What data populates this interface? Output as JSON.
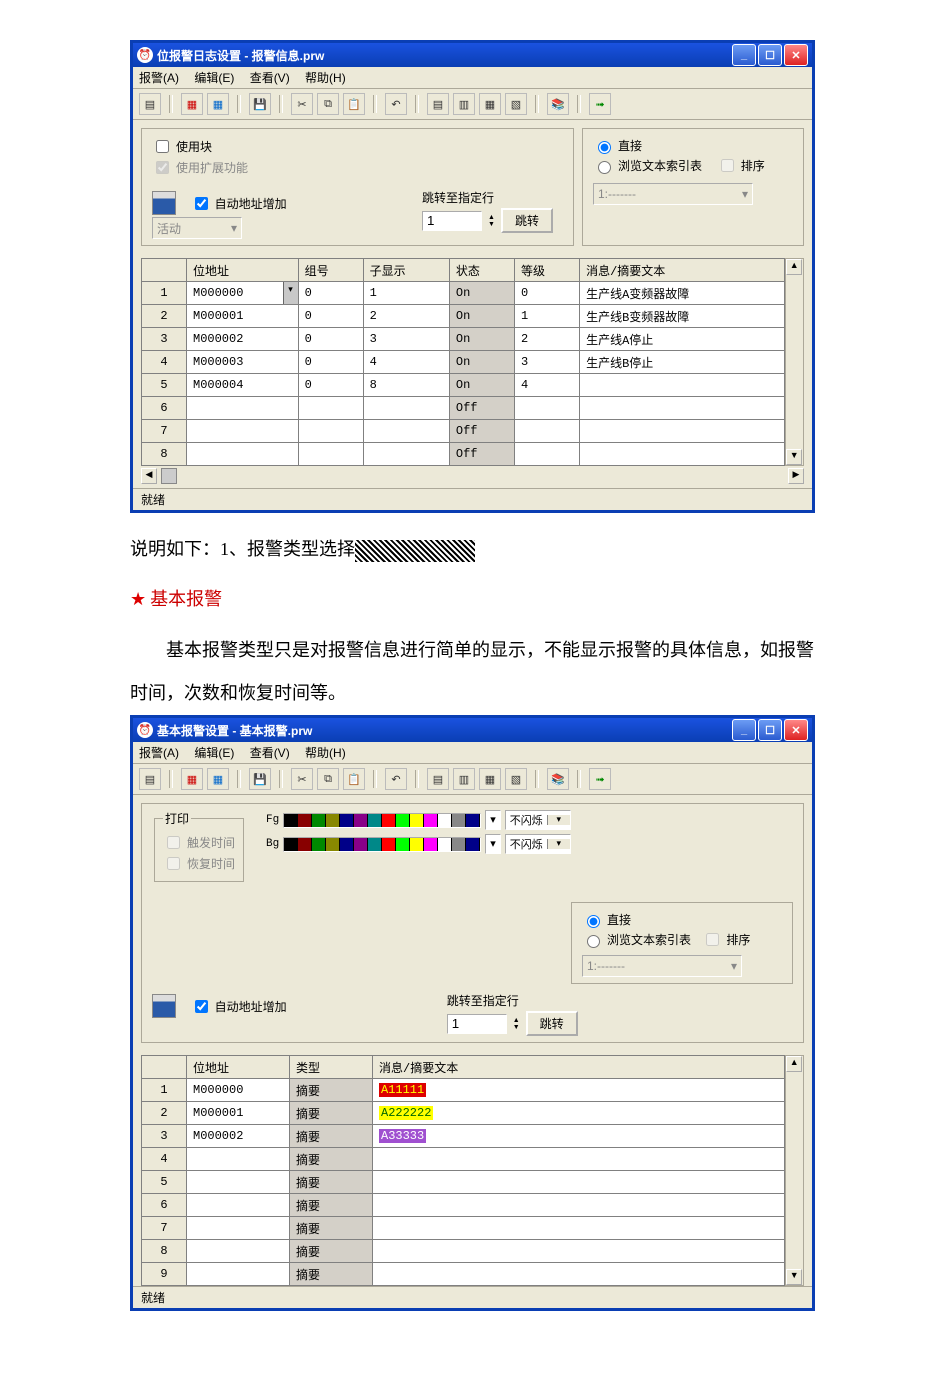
{
  "win1": {
    "title": "位报警日志设置 - 报警信息.prw",
    "menu": {
      "alarm": "报警(A)",
      "edit": "编辑(E)",
      "view": "查看(V)",
      "help": "帮助(H)"
    },
    "opts": {
      "useBlock": "使用块",
      "useExt": "使用扩展功能",
      "autoAddr": "自动地址增加",
      "activity": "活动",
      "jumpLabel": "跳转至指定行",
      "jumpVal": "1",
      "jumpBtn": "跳转",
      "direct": "直接",
      "browse": "浏览文本索引表",
      "sort": "排序"
    },
    "headers": {
      "addr": "位地址",
      "group": "组号",
      "sub": "子显示",
      "state": "状态",
      "level": "等级",
      "msg": "消息/摘要文本"
    },
    "rows": [
      {
        "n": "1",
        "addr": "M000000",
        "group": "0",
        "sub": "1",
        "state": "On",
        "level": "0",
        "msg": "生产线A变频器故障"
      },
      {
        "n": "2",
        "addr": "M000001",
        "group": "0",
        "sub": "2",
        "state": "On",
        "level": "1",
        "msg": "生产线B变频器故障"
      },
      {
        "n": "3",
        "addr": "M000002",
        "group": "0",
        "sub": "3",
        "state": "On",
        "level": "2",
        "msg": "生产线A停止"
      },
      {
        "n": "4",
        "addr": "M000003",
        "group": "0",
        "sub": "4",
        "state": "On",
        "level": "3",
        "msg": "生产线B停止"
      },
      {
        "n": "5",
        "addr": "M000004",
        "group": "0",
        "sub": "8",
        "state": "On",
        "level": "4",
        "msg": ""
      },
      {
        "n": "6",
        "addr": "",
        "group": "",
        "sub": "",
        "state": "Off",
        "level": "",
        "msg": ""
      },
      {
        "n": "7",
        "addr": "",
        "group": "",
        "sub": "",
        "state": "Off",
        "level": "",
        "msg": ""
      },
      {
        "n": "8",
        "addr": "",
        "group": "",
        "sub": "",
        "state": "Off",
        "level": "",
        "msg": ""
      }
    ],
    "status": "就绪"
  },
  "doc": {
    "line1_a": "说明如下：1、报警类型选择",
    "heading": "基本报警",
    "body": "基本报警类型只是对报警信息进行简单的显示，不能显示报警的具体信息，如报警时间，次数和恢复时间等。"
  },
  "win2": {
    "title": "基本报警设置 - 基本报警.prw",
    "menu": {
      "alarm": "报警(A)",
      "edit": "编辑(E)",
      "view": "查看(V)",
      "help": "帮助(H)"
    },
    "print": {
      "label": "打印",
      "trig": "触发时间",
      "rec": "恢复时间"
    },
    "fgbg": {
      "fg": "Fg",
      "bg": "Bg",
      "blink": "不闪烁"
    },
    "opts": {
      "autoAddr": "自动地址增加",
      "jumpLabel": "跳转至指定行",
      "jumpVal": "1",
      "jumpBtn": "跳转",
      "direct": "直接",
      "browse": "浏览文本索引表",
      "sort": "排序"
    },
    "headers": {
      "addr": "位地址",
      "type": "类型",
      "msg": "消息/摘要文本"
    },
    "rows": [
      {
        "n": "1",
        "addr": "M000000",
        "type": "摘要",
        "msg": "A11111",
        "cls": "msg-red"
      },
      {
        "n": "2",
        "addr": "M000001",
        "type": "摘要",
        "msg": "A222222",
        "cls": "msg-yel"
      },
      {
        "n": "3",
        "addr": "M000002",
        "type": "摘要",
        "msg": "A33333",
        "cls": "msg-pur"
      },
      {
        "n": "4",
        "addr": "",
        "type": "摘要",
        "msg": "",
        "cls": ""
      },
      {
        "n": "5",
        "addr": "",
        "type": "摘要",
        "msg": "",
        "cls": ""
      },
      {
        "n": "6",
        "addr": "",
        "type": "摘要",
        "msg": "",
        "cls": ""
      },
      {
        "n": "7",
        "addr": "",
        "type": "摘要",
        "msg": "",
        "cls": ""
      },
      {
        "n": "8",
        "addr": "",
        "type": "摘要",
        "msg": "",
        "cls": ""
      },
      {
        "n": "9",
        "addr": "",
        "type": "摘要",
        "msg": "",
        "cls": ""
      }
    ],
    "status": "就绪"
  },
  "swatches": [
    "#000",
    "#800",
    "#080",
    "#880",
    "#008",
    "#808",
    "#088",
    "#f00",
    "#0f0",
    "#ff0",
    "#f0f",
    "#fff",
    "#888",
    "#008"
  ]
}
